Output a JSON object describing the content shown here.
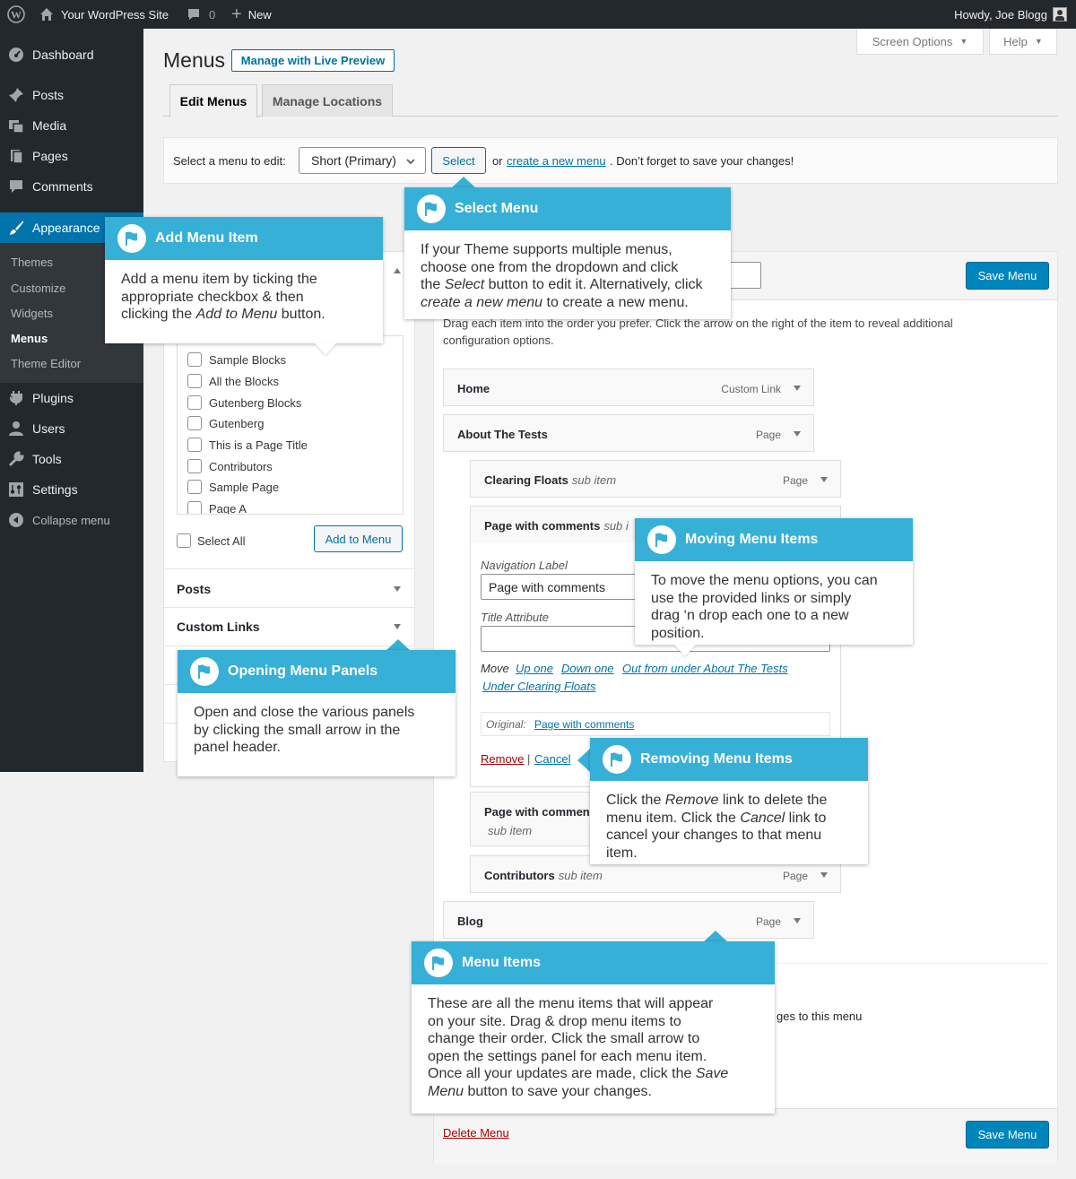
{
  "adminbar": {
    "site_name": "Your WordPress Site",
    "comments_count": "0",
    "new_label": "New",
    "howdy": "Howdy, Joe Blogg"
  },
  "sidebar": {
    "items": [
      {
        "label": "Dashboard",
        "icon": "dashboard-icon"
      },
      {
        "label": "Posts",
        "icon": "pin-icon"
      },
      {
        "label": "Media",
        "icon": "media-icon"
      },
      {
        "label": "Pages",
        "icon": "pages-icon"
      },
      {
        "label": "Comments",
        "icon": "comment-icon"
      },
      {
        "label": "Appearance",
        "icon": "brush-icon"
      },
      {
        "label": "Plugins",
        "icon": "plugin-icon"
      },
      {
        "label": "Users",
        "icon": "user-icon"
      },
      {
        "label": "Tools",
        "icon": "wrench-icon"
      },
      {
        "label": "Settings",
        "icon": "settings-icon"
      },
      {
        "label": "Collapse menu",
        "icon": "collapse-icon"
      }
    ],
    "submenu": [
      "Themes",
      "Customize",
      "Widgets",
      "Menus",
      "Theme Editor"
    ]
  },
  "header": {
    "title": "Menus",
    "live_preview": "Manage with Live Preview",
    "screen_options": "Screen Options",
    "help": "Help"
  },
  "tabs": [
    "Edit Menus",
    "Manage Locations"
  ],
  "select_bar": {
    "label": "Select a menu to edit:",
    "selected": "Short (Primary)",
    "select_btn": "Select",
    "or": "or",
    "create_link": "create a new menu",
    "suffix": ". Don’t forget to save your changes!"
  },
  "left": {
    "checkboxes": [
      "Sample Blocks",
      "All the Blocks",
      "Gutenberg Blocks",
      "Gutenberg",
      "This is a Page Title",
      "Contributors",
      "Sample Page",
      "Page A"
    ],
    "select_all": "Select All",
    "add_to_menu": "Add to Menu",
    "panels": [
      "Posts",
      "Custom Links"
    ]
  },
  "right": {
    "save_menu": "Save Menu",
    "instructions": "Drag each item into the order you prefer. Click the arrow on the right of the item to reveal additional configuration options.",
    "items": [
      {
        "title": "Home",
        "sub": "",
        "type": "Custom Link"
      },
      {
        "title": "About The Tests",
        "sub": "",
        "type": "Page"
      },
      {
        "title": "Clearing Floats",
        "sub": "sub item",
        "type": "Page"
      },
      {
        "title": "Page with comments",
        "sub": "sub i",
        "type": ""
      },
      {
        "title": "Page with commen",
        "sub": "sub item",
        "type": ""
      },
      {
        "title": "Contributors",
        "sub": "sub item",
        "type": "Page"
      },
      {
        "title": "Blog",
        "sub": "",
        "type": "Page"
      }
    ],
    "expanded": {
      "nav_label": "Navigation Label",
      "nav_value": "Page with comments",
      "title_attr": "Title Attribute",
      "move": "Move",
      "up_one": "Up one",
      "down_one": "Down one",
      "out_from": "Out from under About The Tests",
      "under": "Under Clearing Floats",
      "original_label": "Original:",
      "original_link": "Page with comments",
      "remove": "Remove",
      "sep": "|",
      "cancel": "Cancel"
    },
    "settings_partial": "ges to this menu",
    "delete_menu": "Delete Menu"
  },
  "callouts": {
    "select_menu": {
      "title": "Select Menu",
      "body": [
        "If your Theme supports multiple menus,",
        "choose one from the dropdown and click",
        "the ",
        "Select",
        " button to edit it. Alternatively, click",
        "create a new menu",
        " to create a new menu."
      ]
    },
    "add_menu_item": {
      "title": "Add Menu Item",
      "body": [
        "Add a menu item by ticking the",
        "appropriate checkbox & then",
        "clicking the ",
        "Add to Menu",
        " button."
      ]
    },
    "moving": {
      "title": "Moving Menu Items",
      "body": [
        "To move the menu options, you can",
        "use the provided links or simply",
        "drag ‘n drop each one to a new",
        "position."
      ]
    },
    "opening": {
      "title": "Opening Menu Panels",
      "body": [
        "Open and close the various panels",
        "by clicking the small arrow in the",
        "panel header."
      ]
    },
    "removing": {
      "title": "Removing Menu Items",
      "body": [
        "Click the ",
        "Remove",
        " link to delete the",
        "menu item. Click the ",
        "Cancel",
        " link to",
        "cancel your changes to that menu",
        "item."
      ]
    },
    "menu_items": {
      "title": "Menu Items",
      "body": [
        "These are all the menu items that will appear",
        "on your site. Drag & drop menu items to",
        "change their order. Click the small arrow to",
        "open the settings panel for each menu item.",
        "Once all your updates are made, click the ",
        "Save",
        "Menu",
        " button to save your changes."
      ]
    }
  },
  "colors": {
    "admin_dark": "#23282d",
    "accent": "#0073aa",
    "callout": "#36b0d6",
    "remove": "#a00"
  }
}
